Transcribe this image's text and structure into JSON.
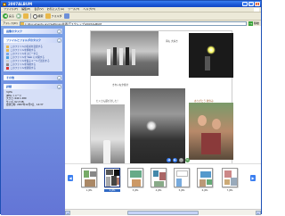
{
  "window": {
    "title": "2007ALBUM"
  },
  "menu": [
    "ファイル(F)",
    "編集(E)",
    "表示(V)",
    "お気に入り(A)",
    "ツール(T)",
    "ヘルプ(H)"
  ],
  "toolbar": {
    "back": "戻る",
    "search": "検索",
    "folders": "フォルダ"
  },
  "address": {
    "label": "アドレス(D)",
    "value": "C:\\Documents and Settings\\共通\\デスクトップ\\2007ALBUM",
    "go": "移動"
  },
  "sidebar": {
    "tasks_title": "画像のタスク",
    "file_title": "ファイルとフォルダのタスク",
    "file_tasks": [
      "このファイルの名前を変更する",
      "このファイルを移動する",
      "このファイルをコピーする",
      "このファイルを Web に公開する",
      "このファイルを電子メールで送信する",
      "このファイルを印刷する",
      "このファイルを削除する"
    ],
    "other_title": "その他",
    "detail_title": "詳細",
    "details": [
      "3.JPG",
      "JPEG イメージ",
      "大きさ: 640 x 480",
      "サイズ: 52.3 KB",
      "更新日時: 2007年12月3日、14:37"
    ]
  },
  "page": {
    "caption1": "海も 大好き",
    "caption2": "きれいな夕焼け",
    "caption3": "たくさん遊びました！",
    "caption4": "ありがとう 夏休み"
  },
  "filmstrip": {
    "labels": [
      "1.JPG",
      "2.JPG",
      "3.JPG",
      "4.JPG",
      "5.JPG",
      "6.JPG",
      "7.JPG"
    ],
    "selected": 1
  }
}
